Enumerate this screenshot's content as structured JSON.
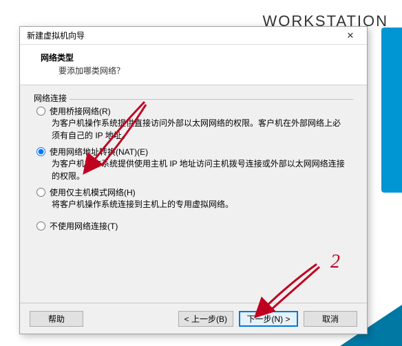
{
  "background": {
    "workstation_text": "WORKSTATION"
  },
  "dialog": {
    "title": "新建虚拟机向导",
    "header": {
      "title": "网络类型",
      "subtitle": "要添加哪类网络？"
    },
    "fieldset_label": "网络连接",
    "options": {
      "bridged": {
        "label": "使用桥接网络(R)",
        "desc": "为客户机操作系统提供直接访问外部以太网网络的权限。客户机在外部网络上必须有自己的 IP 地址。"
      },
      "nat": {
        "label": "使用网络地址转换(NAT)(E)",
        "desc": "为客户机操作系统提供使用主机 IP 地址访问主机拨号连接或外部以太网网络连接的权限。"
      },
      "hostonly": {
        "label": "使用仅主机模式网络(H)",
        "desc": "将客户机操作系统连接到主机上的专用虚拟网络。"
      },
      "none": {
        "label": "不使用网络连接(T)"
      }
    },
    "buttons": {
      "help": "帮助",
      "back": "< 上一步(B)",
      "next": "下一步(N) >",
      "cancel": "取消"
    }
  },
  "annotations": {
    "num2": "2"
  }
}
